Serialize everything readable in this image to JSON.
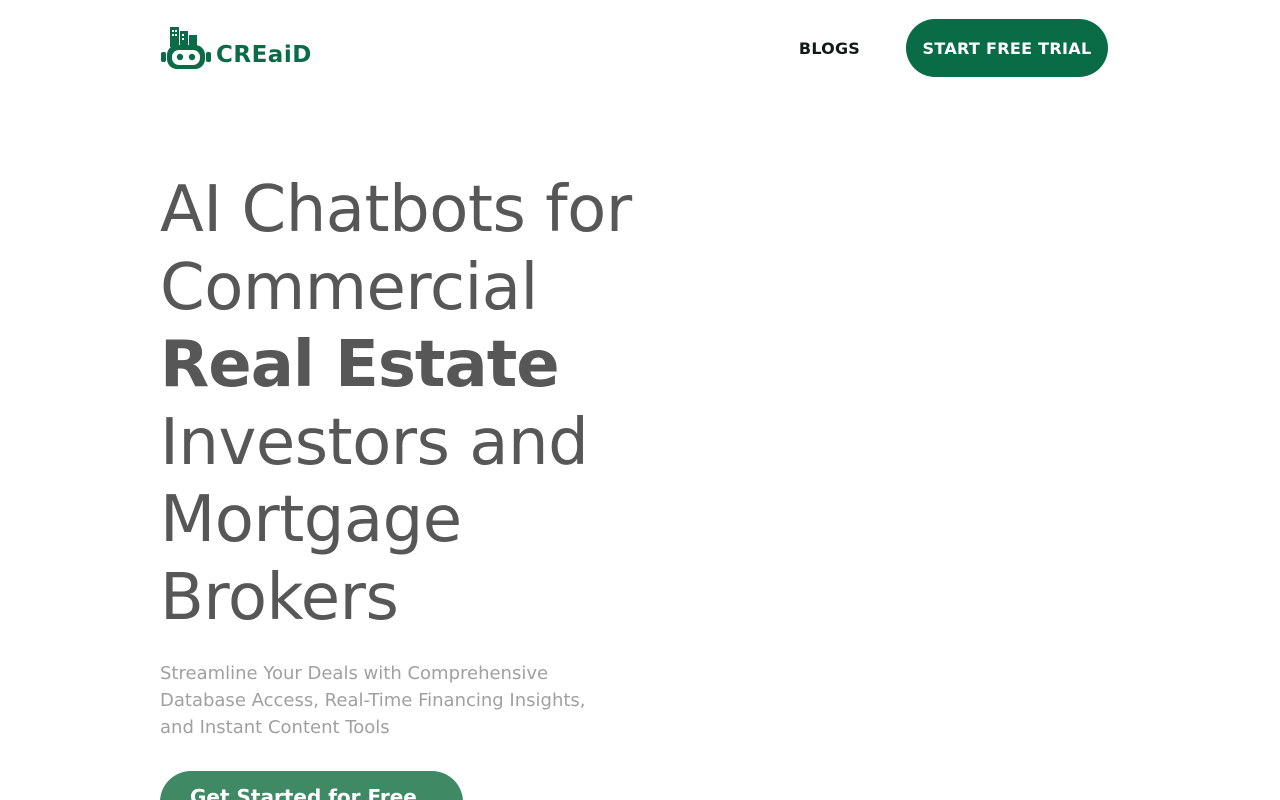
{
  "header": {
    "logo_text": "CREaiD",
    "logo_icon": "robot-building-logo-icon",
    "nav": {
      "blogs_label": "BLOGS",
      "trial_label": "START FREE TRIAL"
    }
  },
  "hero": {
    "title_line1": "AI Chatbots for",
    "title_line2": "Commercial",
    "title_line3_bold": "Real Estate",
    "title_line4": "Investors and",
    "title_line5": "Mortgage",
    "title_line6": "Brokers",
    "subtitle_line1": "Streamline Your Deals with Comprehensive",
    "subtitle_line2": "Database Access, Real-Time Financing Insights,",
    "subtitle_line3": "and Instant Content Tools",
    "cta_label": "Get Started for Free"
  },
  "colors": {
    "brand_green": "#0a6b47",
    "cta_green": "#3f8a64",
    "heading_gray": "#575757",
    "subtitle_gray": "#a0a0a0"
  }
}
